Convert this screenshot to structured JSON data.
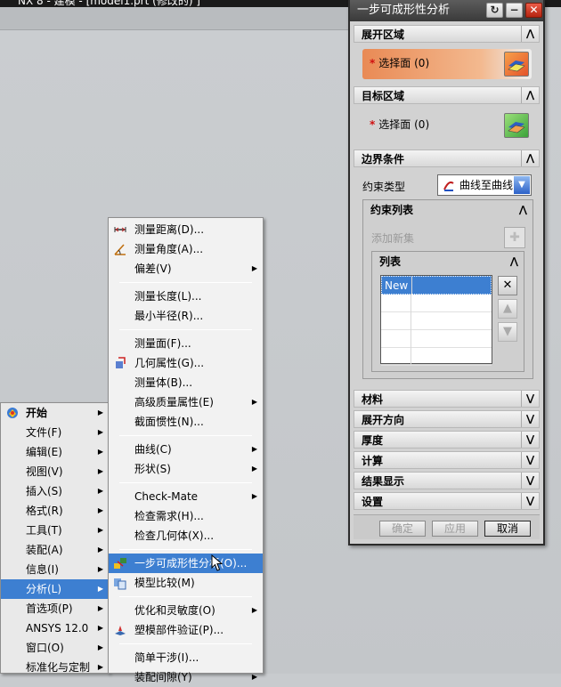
{
  "app": {
    "title_bar_text": "NX 8 - 建模 - [model1.prt (修改的) ]"
  },
  "start_menu": {
    "items": [
      {
        "label": "开始",
        "submenu": true,
        "bold": true,
        "icon": "start-icon"
      },
      {
        "label": "文件(F)",
        "submenu": true
      },
      {
        "label": "编辑(E)",
        "submenu": true
      },
      {
        "label": "视图(V)",
        "submenu": true
      },
      {
        "label": "插入(S)",
        "submenu": true
      },
      {
        "label": "格式(R)",
        "submenu": true
      },
      {
        "label": "工具(T)",
        "submenu": true
      },
      {
        "label": "装配(A)",
        "submenu": true
      },
      {
        "label": "信息(I)",
        "submenu": true
      },
      {
        "label": "分析(L)",
        "submenu": true,
        "highlighted": true
      },
      {
        "label": "首选项(P)",
        "submenu": true
      },
      {
        "label": "ANSYS 12.0",
        "submenu": true
      },
      {
        "label": "窗口(O)",
        "submenu": true
      },
      {
        "label": "标准化与定制",
        "submenu": true
      }
    ]
  },
  "analysis_menu": {
    "items": [
      {
        "label": "测量距离(D)...",
        "icon": "measure-distance-icon"
      },
      {
        "label": "测量角度(A)...",
        "icon": "measure-angle-icon"
      },
      {
        "label": "偏差(V)",
        "submenu": true
      },
      {
        "label": "测量长度(L)..."
      },
      {
        "label": "最小半径(R)..."
      },
      {
        "label": "测量面(F)..."
      },
      {
        "label": "几何属性(G)...",
        "icon": "geometric-properties-icon"
      },
      {
        "label": "测量体(B)..."
      },
      {
        "label": "高级质量属性(E)",
        "submenu": true
      },
      {
        "label": "截面惯性(N)..."
      },
      {
        "label": "曲线(C)",
        "submenu": true
      },
      {
        "label": "形状(S)",
        "submenu": true
      },
      {
        "label": "Check-Mate",
        "submenu": true
      },
      {
        "label": "检查需求(H)..."
      },
      {
        "label": "检查几何体(X)..."
      },
      {
        "label": "一步可成形性分析(O)...",
        "icon": "one-step-formability-icon",
        "highlighted": true
      },
      {
        "label": "模型比较(M)",
        "icon": "model-compare-icon"
      },
      {
        "label": "优化和灵敏度(O)",
        "submenu": true
      },
      {
        "label": "塑模部件验证(P)...",
        "icon": "mold-part-validation-icon"
      },
      {
        "label": "简单干涉(I)..."
      },
      {
        "label": "装配间隙(Y)",
        "submenu": true
      }
    ]
  },
  "dialog": {
    "title": "一步可成形性分析",
    "sections": {
      "unfold_region": "展开区域",
      "target_region": "目标区域",
      "boundary_conditions": "边界条件",
      "material": "材料",
      "unfold_direction": "展开方向",
      "thickness": "厚度",
      "compute": "计算",
      "result_display": "结果显示",
      "settings": "设置"
    },
    "select_face_label": "选择面",
    "select_face_count": "(0)",
    "required_mark": "*",
    "constraint_type_label": "约束类型",
    "constraint_type_value": "曲线至曲线",
    "constraint_list_label": "约束列表",
    "add_new_set_label": "添加新集",
    "list_label": "列表",
    "list_rows": [
      "New",
      "",
      "",
      "",
      ""
    ],
    "buttons": {
      "ok": "确定",
      "apply": "应用",
      "cancel": "取消"
    }
  },
  "colors": {
    "highlight": "#3d7fd1",
    "unfold_row": "#e98a55",
    "required": "#d01010"
  }
}
